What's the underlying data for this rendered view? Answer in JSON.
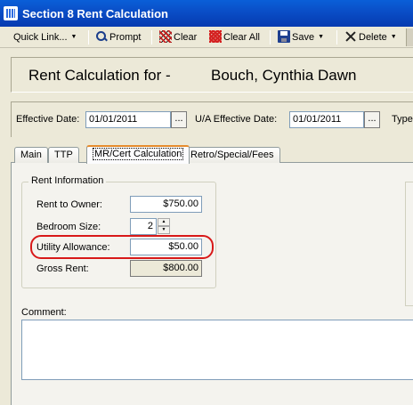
{
  "window": {
    "title": "Section 8 Rent Calculation"
  },
  "toolbar": {
    "quick_link": "Quick Link...",
    "prompt": "Prompt",
    "clear": "Clear",
    "clear_all": "Clear All",
    "save": "Save",
    "delete": "Delete"
  },
  "header": {
    "label": "Rent Calculation for -",
    "tenant_name": "Bouch, Cynthia Dawn"
  },
  "dates": {
    "effective_label": "Effective Date:",
    "effective_value": "01/01/2011",
    "ua_effective_label": "U/A Effective Date:",
    "ua_effective_value": "01/01/2011",
    "type_label": "Type:",
    "browse_label": "..."
  },
  "tabs": [
    {
      "label": "Main"
    },
    {
      "label": "TTP"
    },
    {
      "label": "MR/Cert Calculation",
      "active": true
    },
    {
      "label": "Retro/Special/Fees"
    }
  ],
  "rent_info": {
    "group_title": "Rent Information",
    "rent_to_owner_label": "Rent to Owner:",
    "rent_to_owner_value": "$750.00",
    "bedroom_size_label": "Bedroom Size:",
    "bedroom_size_value": "2",
    "utility_allowance_label": "Utility Allowance:",
    "utility_allowance_value": "$50.00",
    "gross_rent_label": "Gross Rent:",
    "gross_rent_value": "$800.00"
  },
  "comment": {
    "label": "Comment:",
    "value": ""
  },
  "colors": {
    "titlebar": "#0a4fc8",
    "highlight": "#d81919",
    "active_tab_accent": "#e68b2c"
  }
}
